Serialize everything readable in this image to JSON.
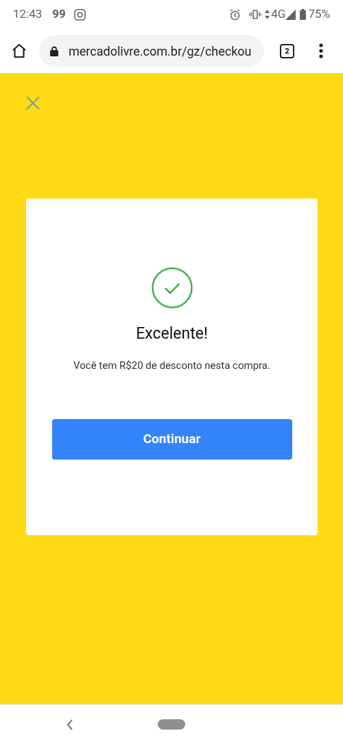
{
  "status_bar": {
    "time": "12:43",
    "app_badge": "99",
    "network": "4G",
    "battery": "75%"
  },
  "browser": {
    "url": "mercadolivre.com.br/gz/checkou",
    "tab_count": "2"
  },
  "dialog": {
    "title": "Excelente!",
    "message": "Você tem R$20 de desconto nesta compra.",
    "button": "Continuar"
  }
}
